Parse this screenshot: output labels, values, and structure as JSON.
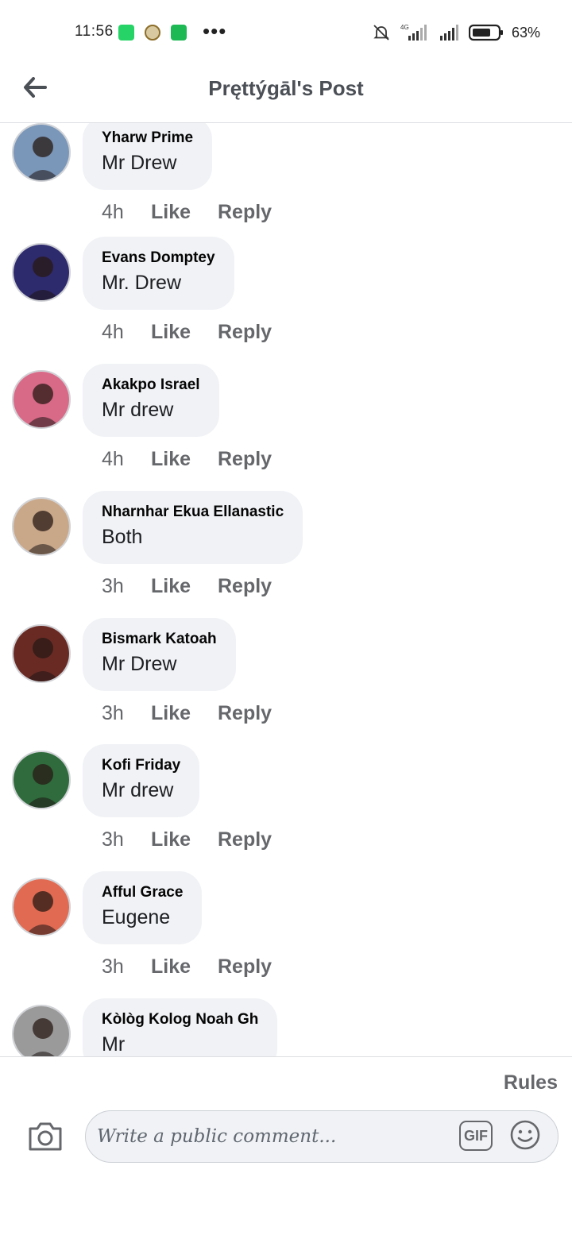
{
  "status_bar": {
    "time": "11:56",
    "dots": "•••",
    "network": "4G",
    "battery_pct": "63%"
  },
  "header": {
    "title": "Pręttýgāl's Post",
    "back_icon": "arrow-left-icon"
  },
  "comments": [
    {
      "author": "Yharw Prime",
      "text": "Mr Drew",
      "time": "4h",
      "like": "Like",
      "reply": "Reply",
      "avatar_color": "#7a96b8"
    },
    {
      "author": "Evans Domptey",
      "text": "Mr.  Drew",
      "time": "4h",
      "like": "Like",
      "reply": "Reply",
      "avatar_color": "#2e2a6e"
    },
    {
      "author": "Akakpo Israel",
      "text": "Mr drew",
      "time": "4h",
      "like": "Like",
      "reply": "Reply",
      "avatar_color": "#d86a88"
    },
    {
      "author": "Nharnhar Ekua Ellanastic",
      "text": "Both",
      "time": "3h",
      "like": "Like",
      "reply": "Reply",
      "avatar_color": "#c9a88a"
    },
    {
      "author": "Bismark Katoah",
      "text": "Mr Drew",
      "time": "3h",
      "like": "Like",
      "reply": "Reply",
      "avatar_color": "#6a2a24"
    },
    {
      "author": "Kofi Friday",
      "text": "Mr drew",
      "time": "3h",
      "like": "Like",
      "reply": "Reply",
      "avatar_color": "#2f6b3c"
    },
    {
      "author": "Afful Grace",
      "text": "Eugene",
      "time": "3h",
      "like": "Like",
      "reply": "Reply",
      "avatar_color": "#e06a52"
    },
    {
      "author": "Kòlòg Kolog Noah Gh",
      "text": "Mr",
      "time": "",
      "like": "",
      "reply": "",
      "avatar_color": "#9a9a9a"
    }
  ],
  "footer": {
    "rules": "Rules",
    "input_placeholder": "Write a public comment...",
    "gif_label": "GIF",
    "camera_icon": "camera-icon",
    "emoji_icon": "smiley-icon"
  }
}
